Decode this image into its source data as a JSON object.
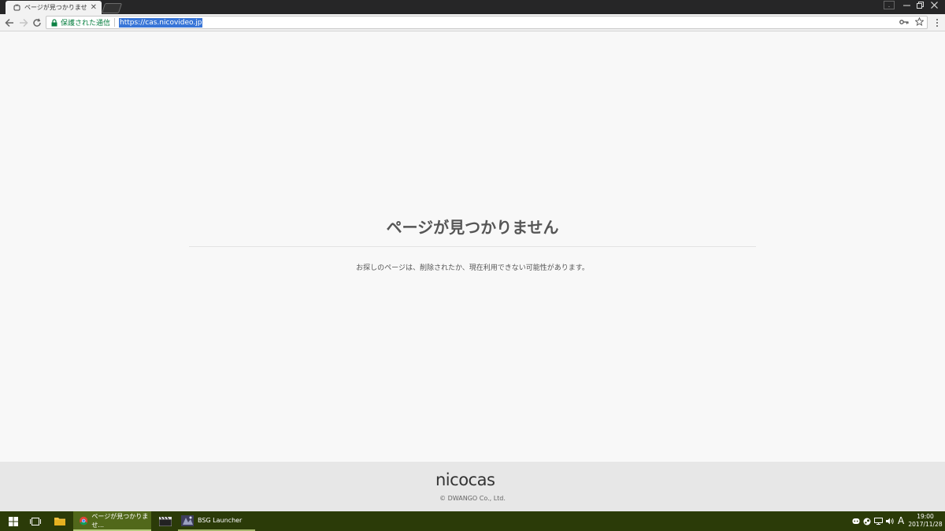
{
  "browser": {
    "tab_title": "ページが見つかりません - nic",
    "security_label": "保護された通信",
    "url": "https://cas.nicovideo.jp"
  },
  "page": {
    "heading": "ページが見つかりません",
    "message": "お探しのページは、削除されたか、現在利用できない可能性があります。"
  },
  "footer": {
    "logo_text": "nicocas",
    "copyright": "© DWANGO Co., Ltd."
  },
  "taskbar": {
    "chrome_window_title": "ページが見つかりませ...",
    "bsg_window_title": "BSG Launcher",
    "ime_indicator": "A",
    "clock_time": "19:00",
    "clock_date": "2017/11/28"
  },
  "colors": {
    "taskbar": "#2b3b08",
    "taskbar_active": "#51681a",
    "secure_green": "#0b8043",
    "url_highlight": "#3875d7",
    "page_background": "#f8f8f8"
  }
}
